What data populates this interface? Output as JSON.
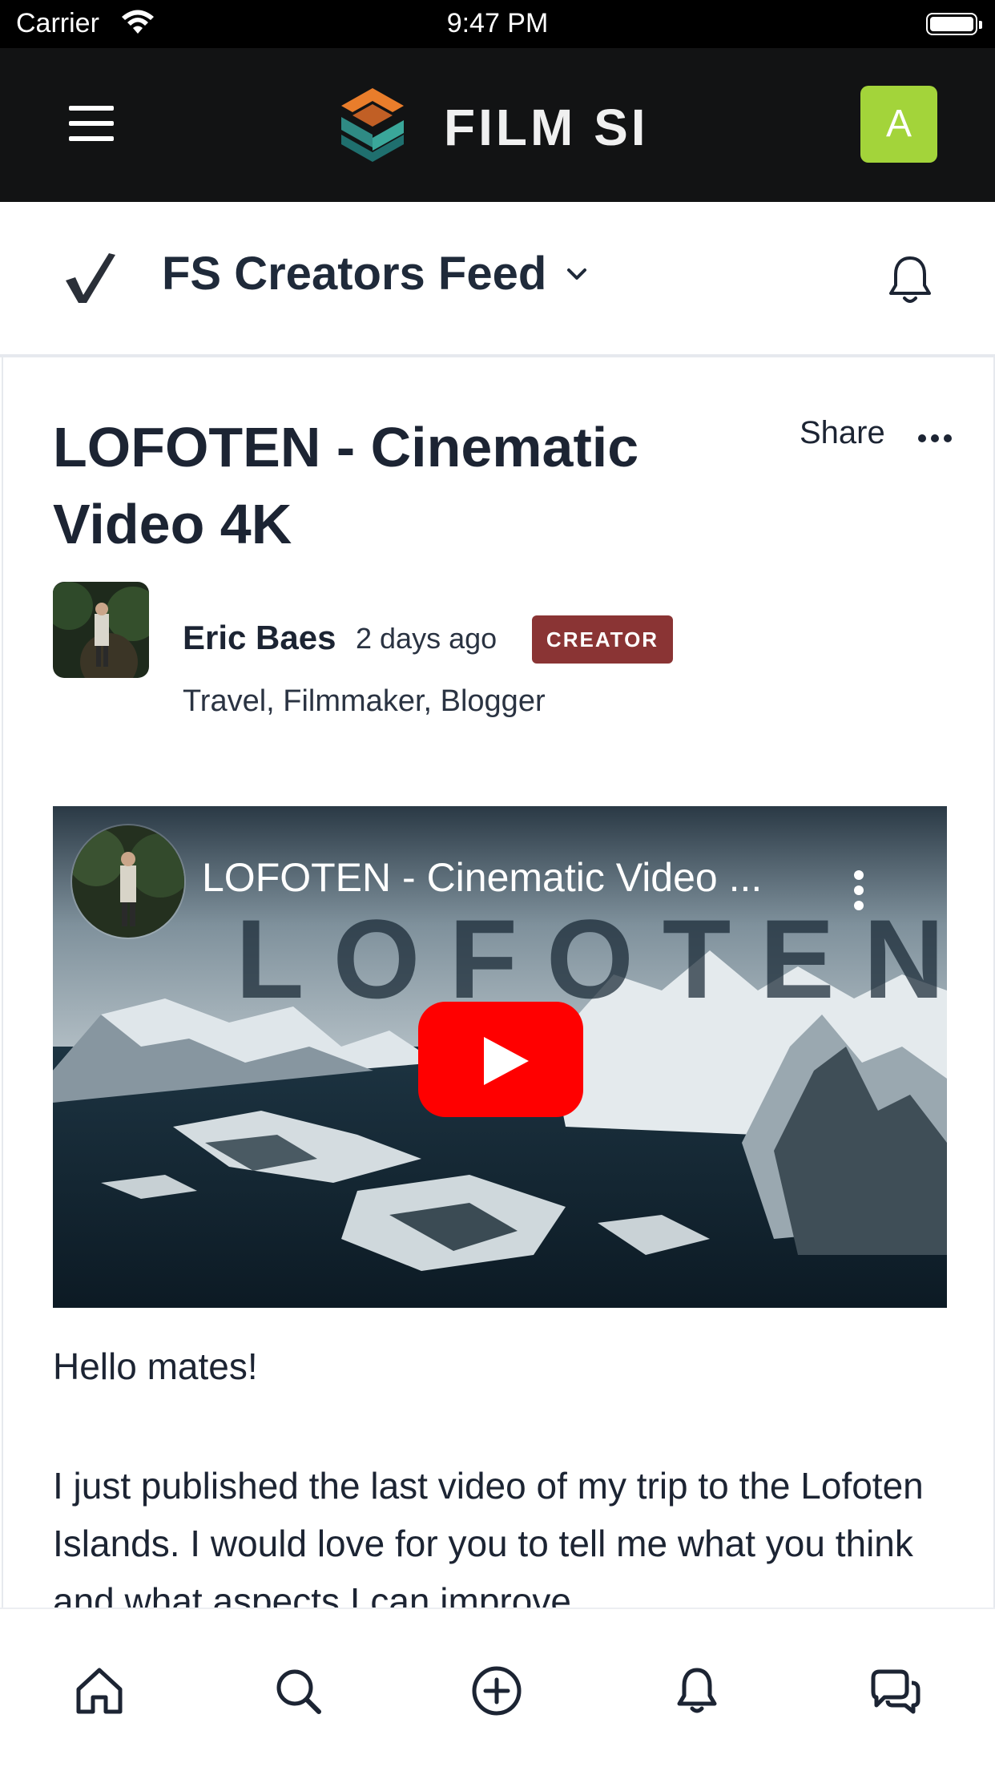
{
  "status_bar": {
    "carrier": "Carrier",
    "time": "9:47 PM"
  },
  "app_bar": {
    "logo_text": "FILM SI",
    "avatar_letter": "A"
  },
  "feed": {
    "title": "FS Creators Feed"
  },
  "post": {
    "title": "LOFOTEN - Cinematic Video 4K",
    "share_label": "Share",
    "author": {
      "name": "Eric Baes",
      "time": "2 days ago",
      "badge": "CREATOR",
      "tags": "Travel, Filmmaker, Blogger"
    },
    "video": {
      "title": "LOFOTEN - Cinematic Video ...",
      "overlay_word": "LOFOTEN"
    },
    "body": {
      "greeting": "Hello mates!",
      "paragraph": "I just published the last video of my trip to the Lofoten Islands. I would love for you to tell me what you think and what aspects I can improve."
    }
  },
  "tab_bar": {
    "items": [
      "home-icon",
      "search-icon",
      "add-icon",
      "notifications-icon",
      "messages-icon"
    ]
  },
  "colors": {
    "app_bar_bg": "#121314",
    "avatar_bg": "#a3d43a",
    "creator_badge": "#8a3434",
    "youtube_red": "#ff0000",
    "text_primary": "#1c2433"
  }
}
